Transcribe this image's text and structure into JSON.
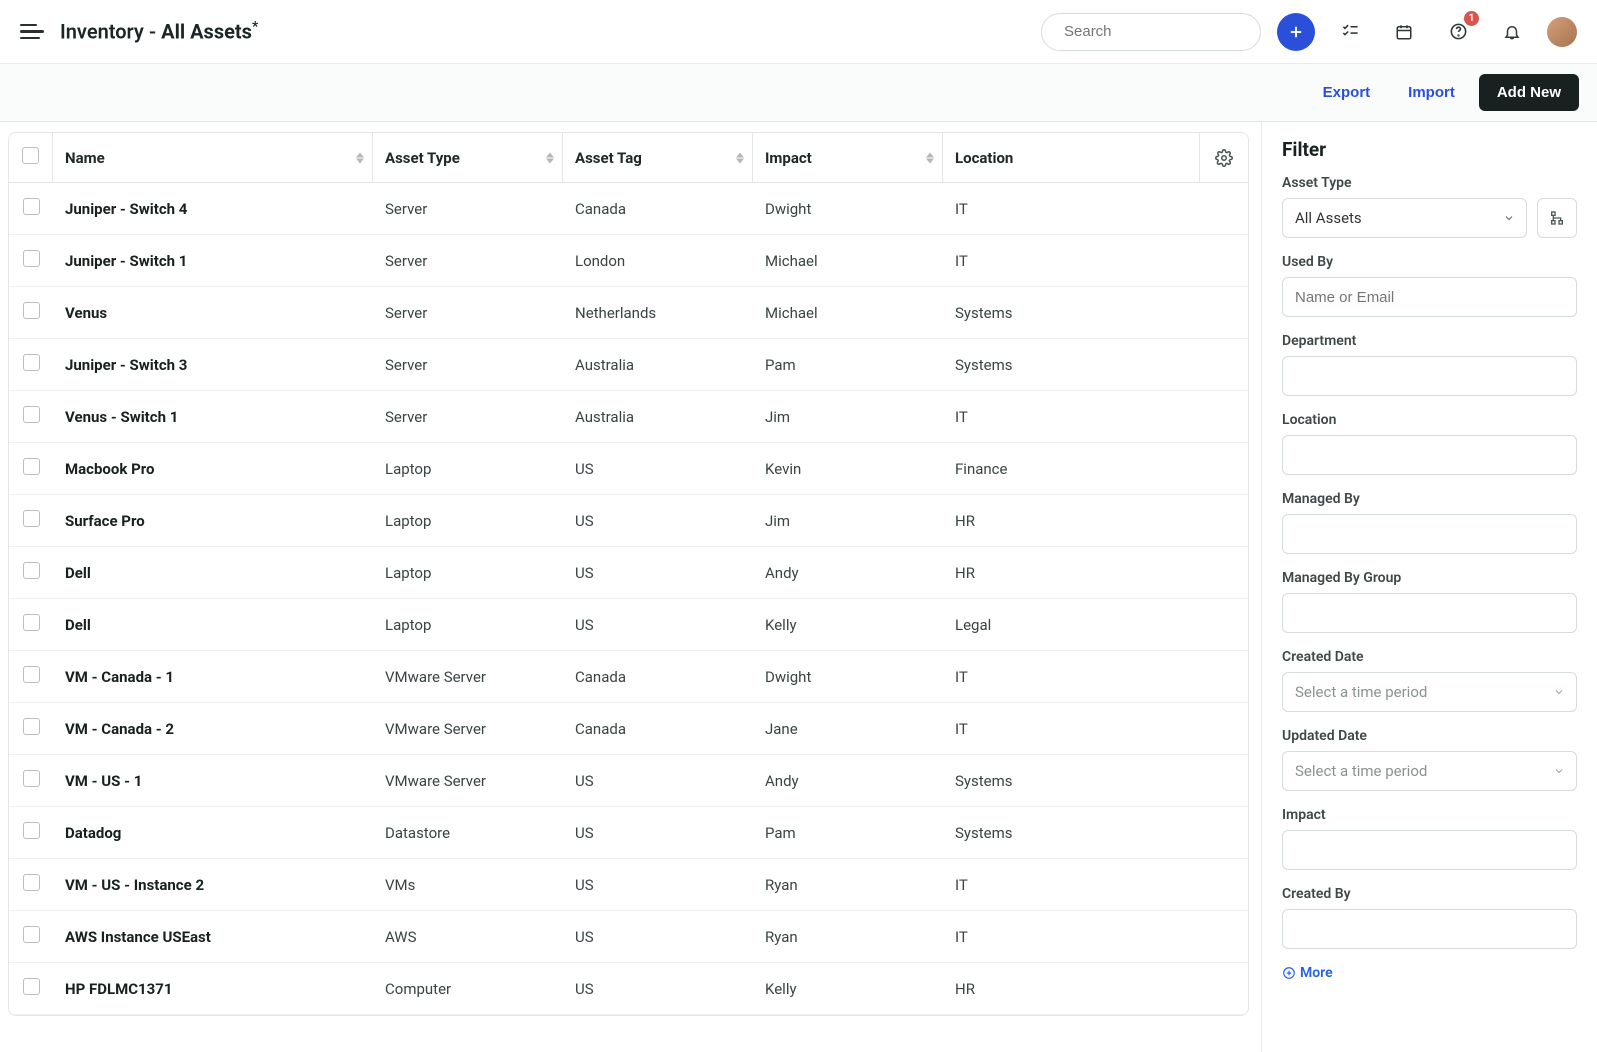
{
  "header": {
    "title_prefix": "Inventory - ",
    "title_strong": "All Assets",
    "title_suffix": "*",
    "search_placeholder": "Search",
    "notification_badge": "1"
  },
  "actions": {
    "export": "Export",
    "import": "Import",
    "add_new": "Add New"
  },
  "columns": {
    "name": "Name",
    "asset_type": "Asset Type",
    "asset_tag": "Asset Tag",
    "impact": "Impact",
    "location": "Location"
  },
  "rows": [
    {
      "name": "Juniper - Switch 4",
      "type": "Server",
      "tag": "Canada",
      "impact": "Dwight",
      "location": "IT"
    },
    {
      "name": "Juniper - Switch 1",
      "type": "Server",
      "tag": "London",
      "impact": "Michael",
      "location": "IT"
    },
    {
      "name": "Venus",
      "type": "Server",
      "tag": "Netherlands",
      "impact": "Michael",
      "location": "Systems"
    },
    {
      "name": "Juniper - Switch 3",
      "type": "Server",
      "tag": "Australia",
      "impact": "Pam",
      "location": "Systems"
    },
    {
      "name": "Venus - Switch 1",
      "type": "Server",
      "tag": "Australia",
      "impact": "Jim",
      "location": "IT"
    },
    {
      "name": "Macbook Pro",
      "type": "Laptop",
      "tag": "US",
      "impact": "Kevin",
      "location": "Finance"
    },
    {
      "name": "Surface Pro",
      "type": "Laptop",
      "tag": "US",
      "impact": "Jim",
      "location": "HR"
    },
    {
      "name": "Dell",
      "type": "Laptop",
      "tag": "US",
      "impact": "Andy",
      "location": "HR"
    },
    {
      "name": "Dell",
      "type": "Laptop",
      "tag": "US",
      "impact": "Kelly",
      "location": "Legal"
    },
    {
      "name": "VM - Canada - 1",
      "type": "VMware Server",
      "tag": "Canada",
      "impact": "Dwight",
      "location": "IT"
    },
    {
      "name": "VM - Canada - 2",
      "type": "VMware Server",
      "tag": "Canada",
      "impact": "Jane",
      "location": "IT"
    },
    {
      "name": "VM - US - 1",
      "type": "VMware Server",
      "tag": "US",
      "impact": "Andy",
      "location": "Systems"
    },
    {
      "name": "Datadog",
      "type": "Datastore",
      "tag": "US",
      "impact": "Pam",
      "location": "Systems"
    },
    {
      "name": "VM - US - Instance 2",
      "type": "VMs",
      "tag": "US",
      "impact": "Ryan",
      "location": "IT"
    },
    {
      "name": "AWS Instance USEast",
      "type": "AWS",
      "tag": "US",
      "impact": "Ryan",
      "location": "IT"
    },
    {
      "name": "HP FDLMC1371",
      "type": "Computer",
      "tag": "US",
      "impact": "Kelly",
      "location": "HR"
    }
  ],
  "filter": {
    "title": "Filter",
    "asset_type_label": "Asset Type",
    "asset_type_value": "All Assets",
    "used_by_label": "Used By",
    "used_by_placeholder": "Name or Email",
    "department_label": "Department",
    "location_label": "Location",
    "managed_by_label": "Managed By",
    "managed_by_group_label": "Managed By Group",
    "created_date_label": "Created Date",
    "created_date_placeholder": "Select a time period",
    "updated_date_label": "Updated Date",
    "updated_date_placeholder": "Select a time period",
    "impact_label": "Impact",
    "created_by_label": "Created By",
    "more": "More"
  }
}
